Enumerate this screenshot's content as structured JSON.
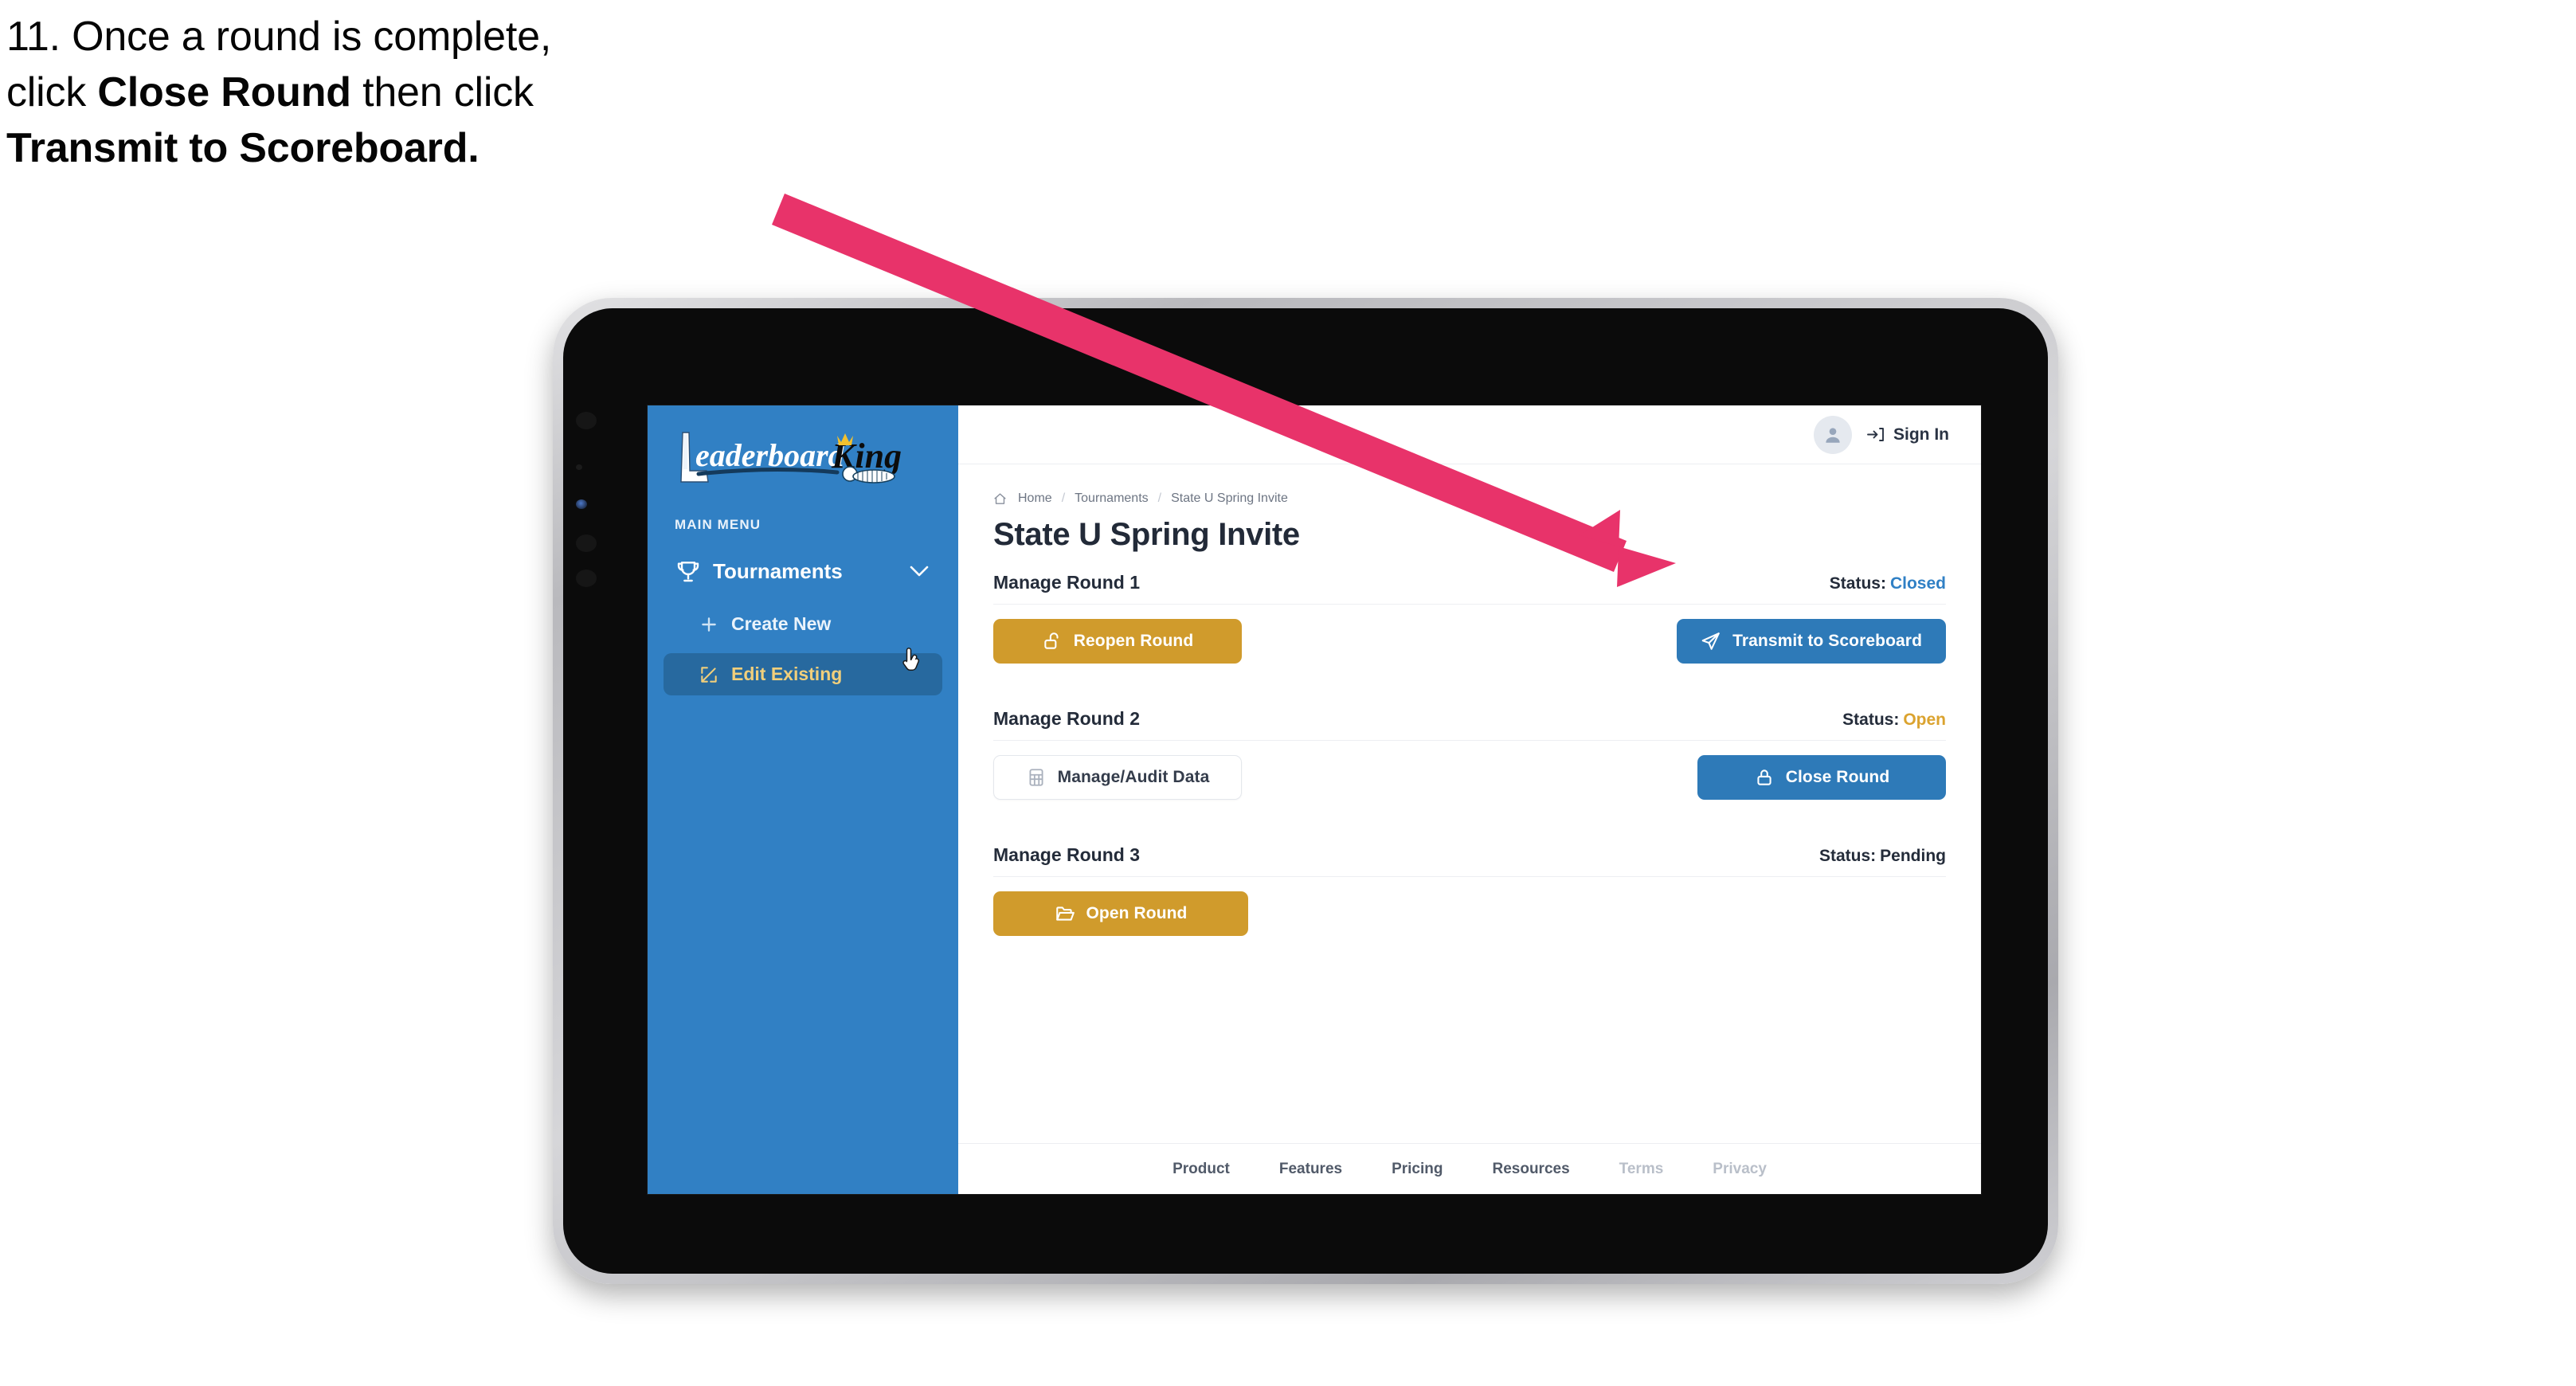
{
  "caption": {
    "line1_plain": "11. Once a round is complete,",
    "line2_prefix": "click ",
    "line2_bold": "Close Round",
    "line2_suffix": " then click",
    "line3_bold": "Transmit to Scoreboard."
  },
  "colors": {
    "sidebar_blue": "#3180C4",
    "sidebar_active": "#27699F",
    "sidebar_active_text": "#F1CF7B",
    "gold_button": "#D09B2C",
    "blue_button": "#2E7AB8",
    "status_closed": "#3080C5",
    "status_open": "#DBA32F",
    "arrow_pink": "#E8336A"
  },
  "sidebar": {
    "logo_primary": "Leaderboard",
    "logo_secondary": "King",
    "menu_label": "MAIN MENU",
    "nav": {
      "group_label": "Tournaments",
      "group_icon": "trophy-icon",
      "chevron_icon": "chevron-down-icon",
      "items": [
        {
          "label": "Create New",
          "icon": "plus-icon",
          "active": false
        },
        {
          "label": "Edit Existing",
          "icon": "pencil-square-icon",
          "active": true
        }
      ]
    },
    "cursor_icon": "hand-pointer-cursor"
  },
  "topbar": {
    "avatar_icon": "user-avatar-icon",
    "signin_icon": "sign-in-icon",
    "signin_label": "Sign In"
  },
  "breadcrumb": {
    "home_icon": "home-icon",
    "items": [
      "Home",
      "Tournaments",
      "State U Spring Invite"
    ],
    "separator": "/"
  },
  "page": {
    "title": "State U Spring Invite"
  },
  "rounds": [
    {
      "name": "Manage Round 1",
      "status_label": "Status:",
      "status_value": "Closed",
      "status_class": "closed",
      "left_button": {
        "label": "Reopen Round",
        "icon": "unlock-icon",
        "style": "btn-gold"
      },
      "right_button": {
        "label": "Transmit to Scoreboard",
        "icon": "paper-plane-icon",
        "style": "btn-blue"
      }
    },
    {
      "name": "Manage Round 2",
      "status_label": "Status:",
      "status_value": "Open",
      "status_class": "open",
      "left_button": {
        "label": "Manage/Audit Data",
        "icon": "table-grid-icon",
        "style": "btn-ghost"
      },
      "right_button": {
        "label": "Close Round",
        "icon": "lock-icon",
        "style": "btn-blue"
      }
    },
    {
      "name": "Manage Round 3",
      "status_label": "Status:",
      "status_value": "Pending",
      "status_class": "pending",
      "left_button": {
        "label": "Open Round",
        "icon": "folder-open-icon",
        "style": "btn-gold"
      },
      "right_button": null
    }
  ],
  "footer": {
    "links": [
      "Product",
      "Features",
      "Pricing",
      "Resources",
      "Terms",
      "Privacy"
    ]
  }
}
